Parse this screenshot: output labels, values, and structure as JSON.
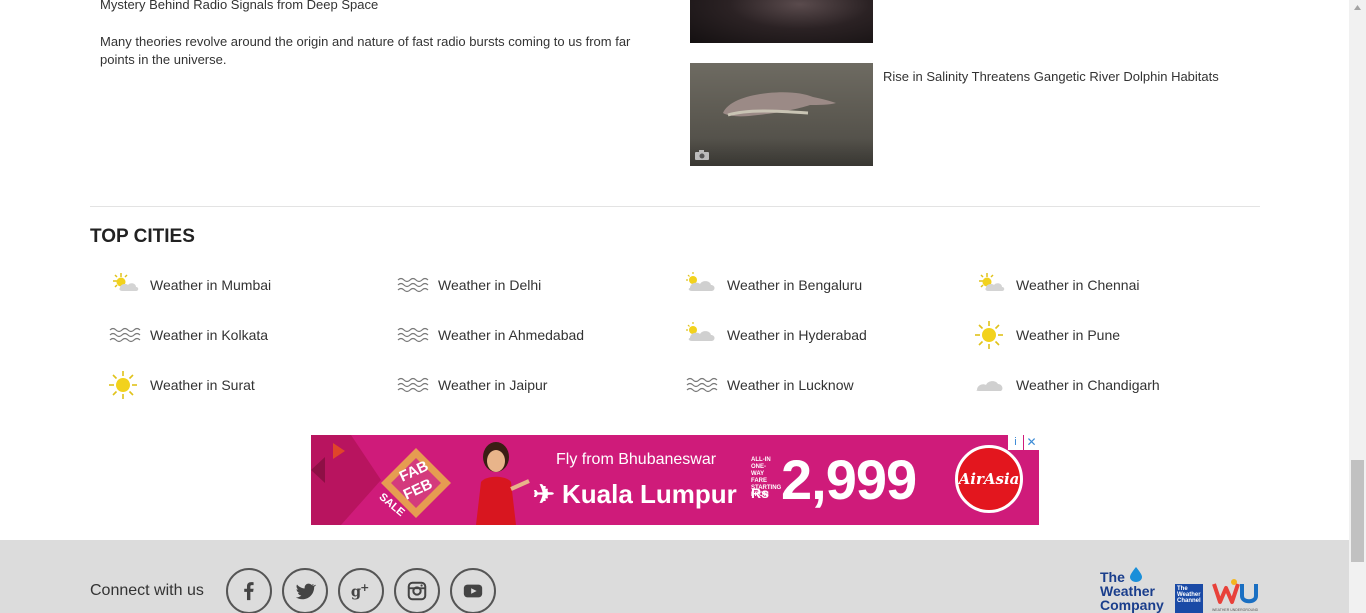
{
  "article_left": {
    "title": "Mystery Behind Radio Signals from Deep Space",
    "description": "Many theories revolve around the origin and nature of fast radio bursts coming to us from far points in the universe."
  },
  "related": {
    "item2_caption": "Rise in Salinity Threatens Gangetic River Dolphin Habitats"
  },
  "top_cities": {
    "title": "TOP CITIES",
    "rows": [
      [
        {
          "label": "Weather in Mumbai",
          "icon": "partly-sunny-icon"
        },
        {
          "label": "Weather in Delhi",
          "icon": "haze-icon"
        },
        {
          "label": "Weather in Bengaluru",
          "icon": "partly-cloudy-icon"
        },
        {
          "label": "Weather in Chennai",
          "icon": "partly-sunny-icon"
        }
      ],
      [
        {
          "label": "Weather in Kolkata",
          "icon": "haze-icon"
        },
        {
          "label": "Weather in Ahmedabad",
          "icon": "haze-icon"
        },
        {
          "label": "Weather in Hyderabad",
          "icon": "partly-cloudy-icon"
        },
        {
          "label": "Weather in Pune",
          "icon": "sun-icon"
        }
      ],
      [
        {
          "label": "Weather in Surat",
          "icon": "sun-icon"
        },
        {
          "label": "Weather in Jaipur",
          "icon": "haze-icon"
        },
        {
          "label": "Weather in Lucknow",
          "icon": "haze-icon"
        },
        {
          "label": "Weather in Chandigarh",
          "icon": "cloud-icon"
        }
      ]
    ]
  },
  "ad": {
    "fab": "FAB",
    "feb": "FEB",
    "sale": "SALE",
    "fly_from": "Fly from Bhubaneswar",
    "destination": "✈ Kuala Lumpur",
    "small_text": "ALL-IN ONE-WAY FARE STARTING FROM",
    "currency": "Rs",
    "price": "2,999",
    "brand": "AirAsia",
    "info_glyph": "i",
    "close_glyph": "✕",
    "bg_color": "#cf1b7a"
  },
  "footer": {
    "connect_label": "Connect with us",
    "social": [
      "facebook-icon",
      "twitter-icon",
      "google-plus-icon",
      "instagram-icon",
      "youtube-icon"
    ],
    "twc_line1": "The",
    "twc_line2": "Weather",
    "twc_line3": "Company",
    "twc_channel": "The Weather Channel",
    "wu_caption": "WEATHER UNDERGROUND"
  }
}
